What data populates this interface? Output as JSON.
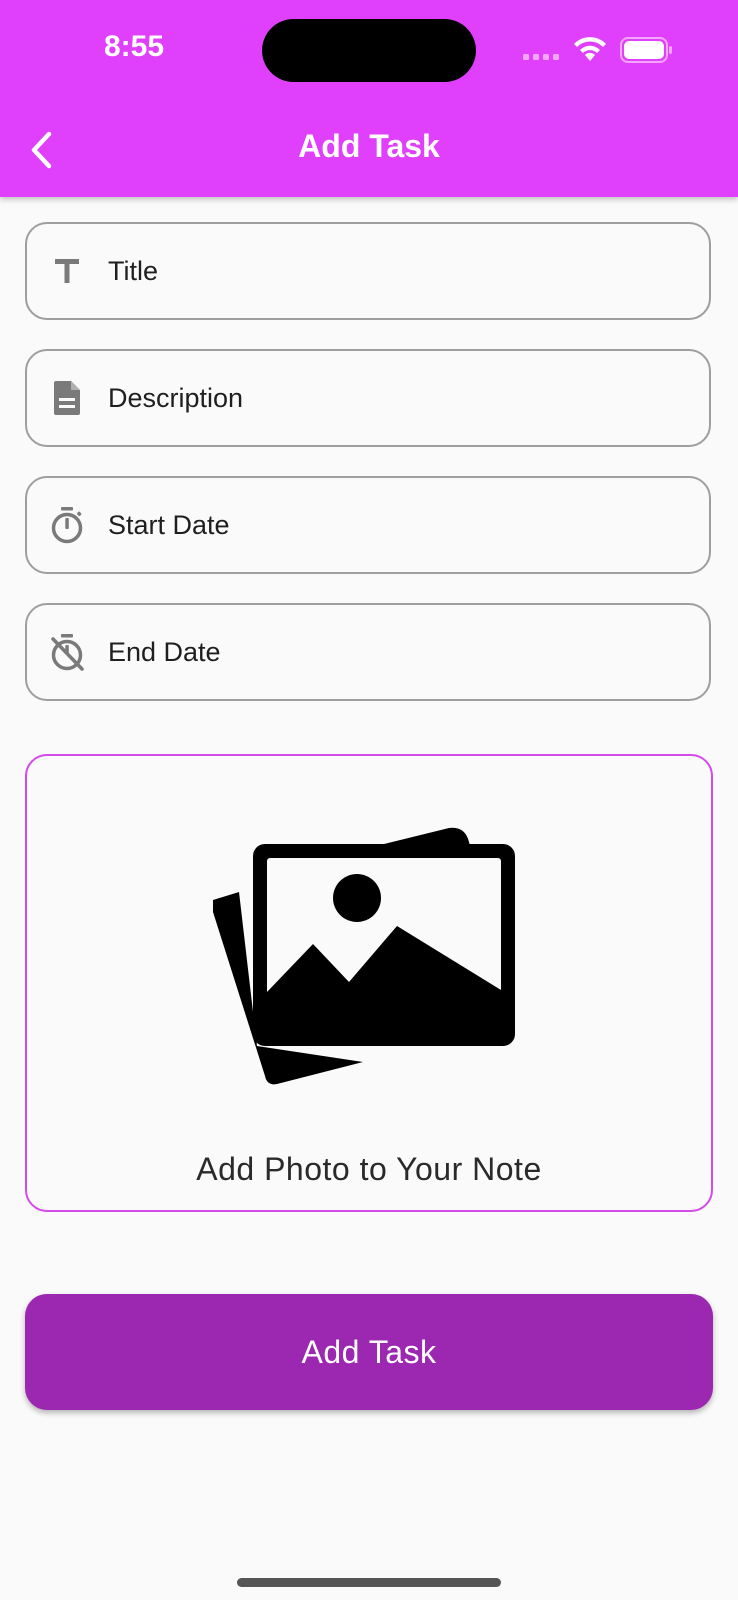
{
  "status_bar": {
    "time": "8:55",
    "icons": [
      "cellular-signal-icon",
      "wifi-icon",
      "battery-icon"
    ]
  },
  "header": {
    "title": "Add Task",
    "back_icon": "chevron-left-icon",
    "background": "#e040fb"
  },
  "form": {
    "fields": [
      {
        "label": "Title",
        "icon": "text-title-icon"
      },
      {
        "label": "Description",
        "icon": "document-icon"
      },
      {
        "label": "Start Date",
        "icon": "timer-icon"
      },
      {
        "label": "End Date",
        "icon": "timer-off-icon"
      }
    ],
    "photo": {
      "label": "Add Photo to Your Note",
      "icon": "photo-library-icon",
      "border_color": "#d44bea"
    },
    "submit": {
      "label": "Add Task",
      "background": "#9c27b0"
    }
  }
}
